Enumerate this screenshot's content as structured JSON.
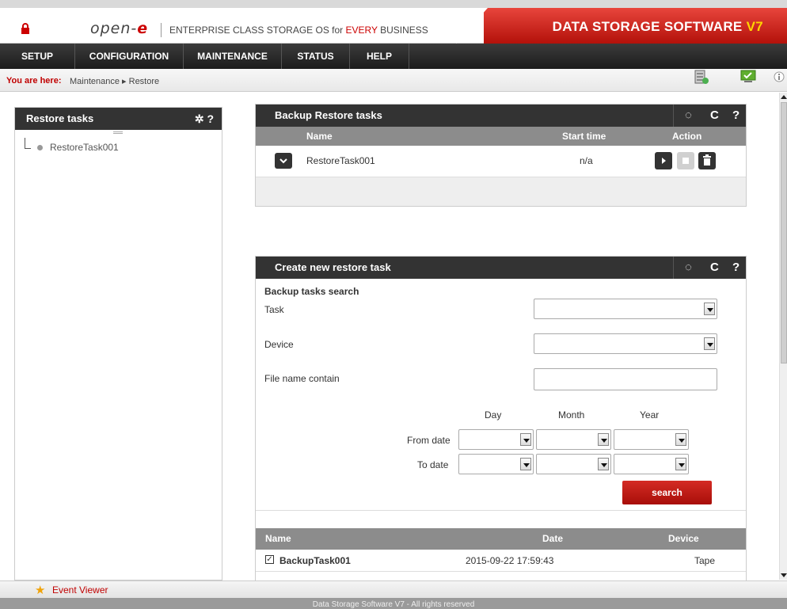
{
  "header": {
    "logo_text": "open-",
    "logo_e": "e",
    "tagline_pre": "ENTERPRISE CLASS STORAGE OS for ",
    "tagline_every": "EVERY",
    "tagline_post": " BUSINESS",
    "brand_text": "DATA STORAGE SOFTWARE ",
    "brand_version": "V7"
  },
  "nav": [
    "SETUP",
    "CONFIGURATION",
    "MAINTENANCE",
    "STATUS",
    "HELP"
  ],
  "breadcrumb": {
    "label": "You are here:",
    "path": "Maintenance ▸ Restore"
  },
  "left_panel": {
    "title": "Restore tasks",
    "tools": "✲ ?",
    "tree_item": "RestoreTask001"
  },
  "backup_restore": {
    "title": "Backup Restore tasks",
    "columns": {
      "name": "Name",
      "start": "Start time",
      "action": "Action"
    },
    "row": {
      "name": "RestoreTask001",
      "start": "n/a"
    }
  },
  "create_task": {
    "title": "Create new restore task",
    "subtitle": "Backup tasks search",
    "task_label": "Task",
    "device_label": "Device",
    "filename_label": "File name contain",
    "day": "Day",
    "month": "Month",
    "year": "Year",
    "from_date": "From date",
    "to_date": "To date",
    "search_label": "search"
  },
  "results": {
    "columns": {
      "name": "Name",
      "date": "Date",
      "device": "Device"
    },
    "row": {
      "name": "BackupTask001",
      "date": "2015-09-22 17:59:43",
      "device": "Tape",
      "checked": "✓"
    }
  },
  "tools": {
    "spinner": "◌",
    "refresh": "C",
    "help": "?"
  },
  "event_viewer": "Event Viewer",
  "footer": "Data Storage Software V7 - All rights reserved"
}
